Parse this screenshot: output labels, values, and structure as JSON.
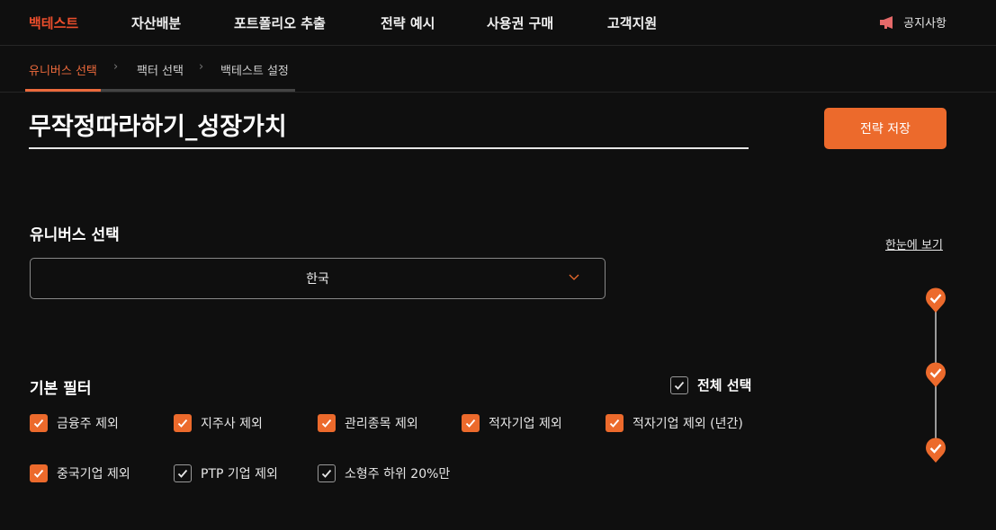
{
  "nav": {
    "items": [
      {
        "label": "백테스트",
        "active": true
      },
      {
        "label": "자산배분",
        "active": false
      },
      {
        "label": "포트폴리오 추출",
        "active": false
      },
      {
        "label": "전략 예시",
        "active": false
      },
      {
        "label": "사용권 구매",
        "active": false
      },
      {
        "label": "고객지원",
        "active": false
      }
    ],
    "notice_label": "공지사항"
  },
  "steps": [
    {
      "label": "유니버스 선택",
      "active": true
    },
    {
      "label": "팩터 선택",
      "active": false
    },
    {
      "label": "백테스트 설정",
      "active": false
    }
  ],
  "strategy": {
    "title": "무작정따라하기_성장가치",
    "save_label": "전략 저장"
  },
  "universe": {
    "section_title": "유니버스 선택",
    "overview_link": "한눈에 보기",
    "selected_country": "한국"
  },
  "filters": {
    "section_title": "기본 필터",
    "select_all_label": "전체 선택",
    "select_all_checked": false,
    "items": [
      {
        "label": "금융주 제외",
        "checked": true
      },
      {
        "label": "지주사 제외",
        "checked": true
      },
      {
        "label": "관리종목 제외",
        "checked": true
      },
      {
        "label": "적자기업 제외",
        "checked": true
      },
      {
        "label": "적자기업 제외 (년간)",
        "checked": true
      },
      {
        "label": "중국기업 제외",
        "checked": true
      },
      {
        "label": "PTP 기업 제외",
        "checked": false
      },
      {
        "label": "소형주 하위 20%만",
        "checked": false
      }
    ]
  },
  "colors": {
    "accent": "#ec6a2c",
    "nav_active": "#ec4e2c",
    "background": "#0f0f0f"
  }
}
